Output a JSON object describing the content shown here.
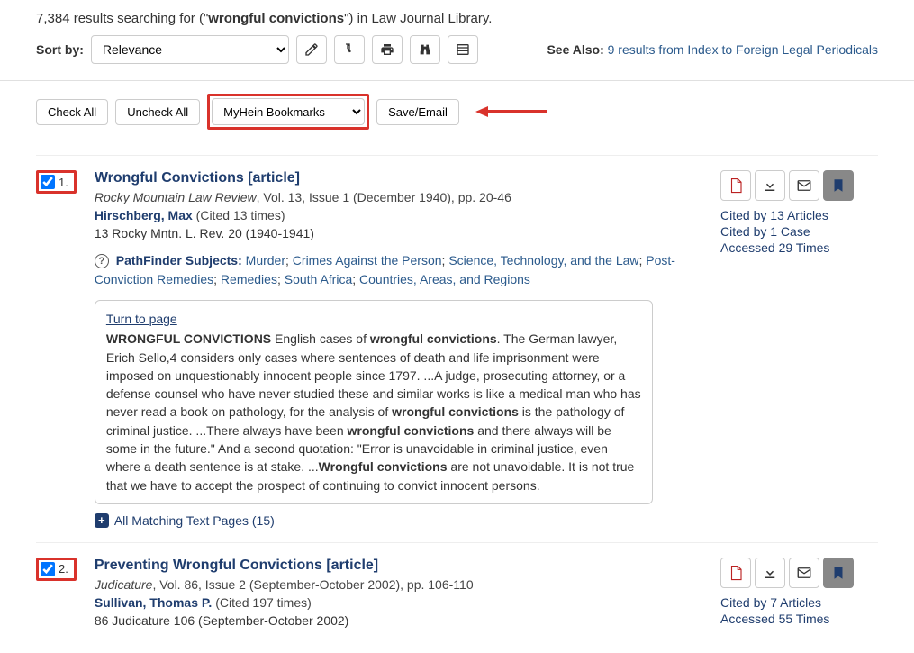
{
  "header": {
    "result_count": "7,384",
    "results_prefix": "results searching for (\"",
    "query": "wrongful convictions",
    "results_suffix": "\") in Law Journal Library."
  },
  "sort": {
    "label": "Sort by:",
    "selected": "Relevance"
  },
  "see_also": {
    "label": "See Also:",
    "link_text": "9 results from Index to Foreign Legal Periodicals"
  },
  "actions": {
    "check_all": "Check All",
    "uncheck_all": "Uncheck All",
    "bookmarks_select": "MyHein Bookmarks",
    "save_email": "Save/Email"
  },
  "results": [
    {
      "num": "1.",
      "checked": true,
      "title": "Wrongful Convictions [article]",
      "journal": "Rocky Mountain Law Review",
      "meta_rest": ", Vol. 13, Issue 1 (December 1940), pp. 20-46",
      "author": "Hirschberg, Max",
      "cited_times": "(Cited 13 times)",
      "citation": "13 Rocky Mntn. L. Rev. 20 (1940-1941)",
      "subjects_label": "PathFinder Subjects:",
      "subjects_html": "Murder; Crimes Against the Person; Science, Technology, and the Law; Post-Conviction Remedies; Remedies; South Africa; Countries, Areas, and Regions",
      "turn_to_page": "Turn to page",
      "snippet_html": "<b>WRONGFUL CONVICTIONS</b> English cases of <b>wrongful convictions</b>. The German lawyer, Erich Sello,4 considers only cases where sentences of death and life imprisonment were imposed on unquestionably innocent people since 1797. ...A judge, prosecuting attorney, or a defense counsel who have never studied these and similar works is like a medical man who has never read a book on pathology, for the analysis of <b>wrongful convictions</b> is the pathology of criminal justice. ...There always have been <b>wrongful convictions</b> and there always will be some in the future.\" And a second quotation: \"Error is unavoidable in criminal justice, even where a death sentence is at stake. ...<b>Wrongful convictions</b> are not unavoidable. It is not true that we have to accept the prospect of continuing to convict innocent persons.",
      "matching_pages": "All Matching Text Pages (15)",
      "stats": {
        "cited_articles": "Cited by 13 Articles",
        "cited_cases": "Cited by 1 Case",
        "accessed": "Accessed 29 Times"
      }
    },
    {
      "num": "2.",
      "checked": true,
      "title": "Preventing Wrongful Convictions [article]",
      "journal": "Judicature",
      "meta_rest": ", Vol. 86, Issue 2 (September-October 2002), pp. 106-110",
      "author": "Sullivan, Thomas P.",
      "cited_times": "(Cited 197 times)",
      "citation": "86 Judicature 106 (September-October 2002)",
      "stats": {
        "cited_articles": "Cited by 7 Articles",
        "accessed": "Accessed 55 Times"
      }
    }
  ]
}
